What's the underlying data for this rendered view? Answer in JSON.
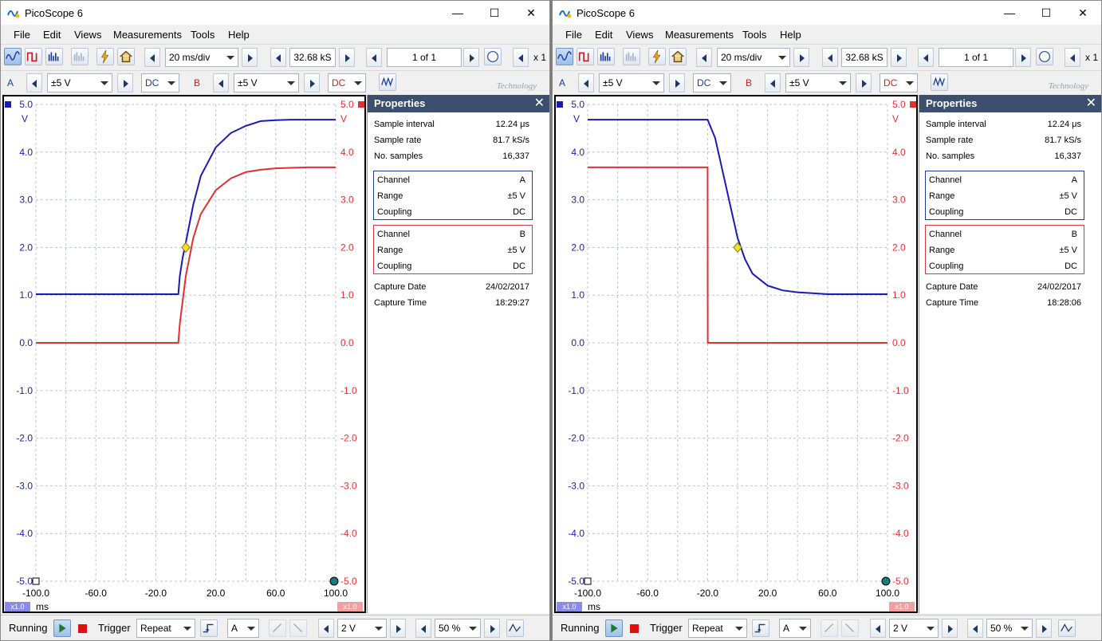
{
  "windows": [
    {
      "title": "PicoScope 6",
      "window_buttons": {
        "minimize": "—",
        "maximize": "☐",
        "close": "✕"
      },
      "menu": [
        "File",
        "Edit",
        "Views",
        "Measurements",
        "Tools",
        "Help"
      ],
      "toolbar": {
        "timebase": "20 ms/div",
        "samples": "32.68 kS",
        "buffer": "1 of 1",
        "zoom": "x 1"
      },
      "channel_bar": {
        "a_label": "A",
        "a_range": "±5 V",
        "a_coupling": "DC",
        "b_label": "B",
        "b_range": "±5 V",
        "b_coupling": "DC",
        "brand": "Technology"
      },
      "scope": {
        "y_unit": "V",
        "x_unit": "ms",
        "left_ticks": [
          "5.0",
          "4.0",
          "3.0",
          "2.0",
          "1.0",
          "0.0",
          "-1.0",
          "-2.0",
          "-3.0",
          "-4.0",
          "-5.0"
        ],
        "right_ticks": [
          "5.0",
          "4.0",
          "3.0",
          "2.0",
          "1.0",
          "0.0",
          "-1.0",
          "-2.0",
          "-3.0",
          "-4.0",
          "-5.0"
        ],
        "x_ticks": [
          "-100.0",
          "-60.0",
          "-20.0",
          "20.0",
          "60.0",
          "100.0"
        ],
        "zoom_left": "x1.0",
        "zoom_right": "x1.0"
      },
      "chart_data": {
        "type": "line",
        "xlabel": "ms",
        "ylabel": "V",
        "xlim": [
          -100,
          100
        ],
        "ylim": [
          -5,
          5
        ],
        "grid": true,
        "series": [
          {
            "name": "A",
            "color": "#1a1ab8",
            "x": [
              -100,
              -5,
              -4,
              -2,
              0,
              5,
              10,
              20,
              30,
              40,
              50,
              60,
              70,
              80,
              90,
              100
            ],
            "y": [
              1.02,
              1.02,
              1.4,
              1.8,
              2.1,
              2.9,
              3.5,
              4.1,
              4.4,
              4.55,
              4.65,
              4.67,
              4.68,
              4.68,
              4.68,
              4.68
            ]
          },
          {
            "name": "B",
            "color": "#e03030",
            "x": [
              -100,
              -5,
              -4,
              -2,
              0,
              5,
              10,
              20,
              30,
              40,
              50,
              60,
              70,
              80,
              90,
              100
            ],
            "y": [
              0.0,
              0.0,
              0.4,
              0.9,
              1.4,
              2.2,
              2.7,
              3.2,
              3.45,
              3.58,
              3.63,
              3.66,
              3.67,
              3.68,
              3.68,
              3.68
            ]
          }
        ],
        "trigger": {
          "x": 0,
          "y": 2.0
        }
      },
      "properties": {
        "title": "Properties",
        "close": "✕",
        "sample_interval_label": "Sample interval",
        "sample_interval": "12.24 μs",
        "sample_rate_label": "Sample rate",
        "sample_rate": "81.7 kS/s",
        "no_samples_label": "No. samples",
        "no_samples": "16,337",
        "channel_label": "Channel",
        "range_label": "Range",
        "coupling_label": "Coupling",
        "a_channel": "A",
        "a_range": "±5 V",
        "a_coupling": "DC",
        "b_channel": "B",
        "b_range": "±5 V",
        "b_coupling": "DC",
        "capture_date_label": "Capture Date",
        "capture_date": "24/02/2017",
        "capture_time_label": "Capture Time",
        "capture_time": "18:29:27"
      },
      "status": {
        "running": "Running",
        "trigger": "Trigger",
        "trigger_mode": "Repeat",
        "trigger_channel": "A",
        "trigger_level": "2 V",
        "pre_trigger": "50 %"
      }
    },
    {
      "title": "PicoScope 6",
      "window_buttons": {
        "minimize": "—",
        "maximize": "☐",
        "close": "✕"
      },
      "menu": [
        "File",
        "Edit",
        "Views",
        "Measurements",
        "Tools",
        "Help"
      ],
      "toolbar": {
        "timebase": "20 ms/div",
        "samples": "32.68 kS",
        "buffer": "1 of 1",
        "zoom": "x 1"
      },
      "channel_bar": {
        "a_label": "A",
        "a_range": "±5 V",
        "a_coupling": "DC",
        "b_label": "B",
        "b_range": "±5 V",
        "b_coupling": "DC",
        "brand": "Technology"
      },
      "scope": {
        "y_unit": "V",
        "x_unit": "ms",
        "left_ticks": [
          "5.0",
          "4.0",
          "3.0",
          "2.0",
          "1.0",
          "0.0",
          "-1.0",
          "-2.0",
          "-3.0",
          "-4.0",
          "-5.0"
        ],
        "right_ticks": [
          "5.0",
          "4.0",
          "3.0",
          "2.0",
          "1.0",
          "0.0",
          "-1.0",
          "-2.0",
          "-3.0",
          "-4.0",
          "-5.0"
        ],
        "x_ticks": [
          "-100.0",
          "-60.0",
          "-20.0",
          "20.0",
          "60.0",
          "100.0"
        ],
        "zoom_left": "x1.0",
        "zoom_right": "x1.0"
      },
      "chart_data": {
        "type": "line",
        "xlabel": "ms",
        "ylabel": "V",
        "xlim": [
          -100,
          100
        ],
        "ylim": [
          -5,
          5
        ],
        "grid": true,
        "series": [
          {
            "name": "A",
            "color": "#1a1ab8",
            "x": [
              -100,
              -20,
              -15,
              -10,
              -5,
              0,
              5,
              10,
              20,
              30,
              40,
              50,
              60,
              70,
              80,
              90,
              100
            ],
            "y": [
              4.68,
              4.68,
              4.3,
              3.6,
              2.9,
              2.2,
              1.75,
              1.45,
              1.2,
              1.1,
              1.06,
              1.04,
              1.02,
              1.02,
              1.02,
              1.02,
              1.02
            ]
          },
          {
            "name": "B",
            "color": "#e03030",
            "x": [
              -100,
              -20,
              -19.9,
              100
            ],
            "y": [
              3.68,
              3.68,
              0.0,
              0.0
            ]
          }
        ],
        "trigger": {
          "x": 0,
          "y": 2.0
        }
      },
      "properties": {
        "title": "Properties",
        "close": "✕",
        "sample_interval_label": "Sample interval",
        "sample_interval": "12.24 μs",
        "sample_rate_label": "Sample rate",
        "sample_rate": "81.7 kS/s",
        "no_samples_label": "No. samples",
        "no_samples": "16,337",
        "channel_label": "Channel",
        "range_label": "Range",
        "coupling_label": "Coupling",
        "a_channel": "A",
        "a_range": "±5 V",
        "a_coupling": "DC",
        "b_channel": "B",
        "b_range": "±5 V",
        "b_coupling": "DC",
        "capture_date_label": "Capture Date",
        "capture_date": "24/02/2017",
        "capture_time_label": "Capture Time",
        "capture_time": "18:28:06"
      },
      "status": {
        "running": "Running",
        "trigger": "Trigger",
        "trigger_mode": "Repeat",
        "trigger_channel": "A",
        "trigger_level": "2 V",
        "pre_trigger": "50 %"
      }
    }
  ]
}
